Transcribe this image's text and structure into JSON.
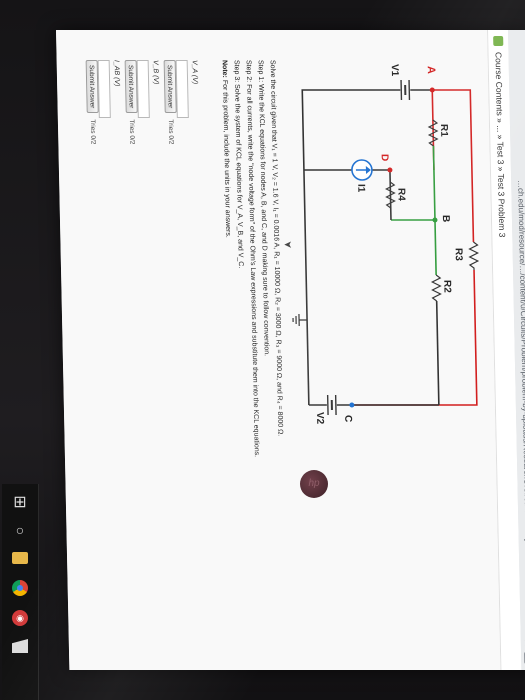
{
  "browser": {
    "url": "…ch.edu/mod/resource/…/content/0/Circuits/Problem/problem-by-uploads/ResearchOfCircuitsDelivery",
    "star_icon": "star-icon",
    "menu_icon": "menu-icon"
  },
  "breadcrumb": {
    "text": "Course Contents » ... » Test 3 » Test 3 Problem 3"
  },
  "circuit": {
    "labels": {
      "R3": "R3",
      "R1": "R1",
      "B": "B",
      "R2": "R2",
      "A": "A",
      "C": "C",
      "V1": "V1",
      "V2": "V2",
      "R4": "R4",
      "D": "D",
      "I1": "I1"
    },
    "colors": {
      "wire_top": "#d21f1f",
      "wire": "#333333",
      "node_b": "#2f9b3a",
      "source": "#1c6fd0",
      "label_red": "#d21f1f"
    }
  },
  "problem": {
    "given_prefix": "Solve the circuit given that",
    "given_values": "V₁ = 1 V, V₂ = 1.6 V, I₁ = 0.0016 A, R₁ = 10000 Ω, R₂ = 3000 Ω, R₃ = 9000 Ω, and R₄ = 8000 Ω.",
    "step1": "Step 1: Write the KCL equations for nodes A, B, and C, and D making sure to follow convention.",
    "step2": "Step 2: For all currents, write the \"node voltage form\" of the Ohm's Law expressions and substitute them into the KCL equations.",
    "step3": "Step 3: Solve the system of KCL equations for V_A, V_B, and V_C.",
    "note_label": "Note:",
    "note_text": "For this problem, include the units in your answers."
  },
  "answers": [
    {
      "label": "V_A (V)",
      "value": "",
      "submit": "Submit Answer",
      "tries": "Tries 0/2"
    },
    {
      "label": "V_B (V)",
      "value": "",
      "submit": "Submit Answer",
      "tries": "Tries 0/2"
    },
    {
      "label": "I_AB (V)",
      "value": "",
      "submit": "Submit Answer",
      "tries": "Tries 0/2"
    }
  ],
  "taskbar": {
    "icons": [
      "windows-icon",
      "search-icon",
      "folder-icon",
      "chrome-icon",
      "red-app-icon",
      "store-icon"
    ]
  },
  "hp_logo": "hp"
}
